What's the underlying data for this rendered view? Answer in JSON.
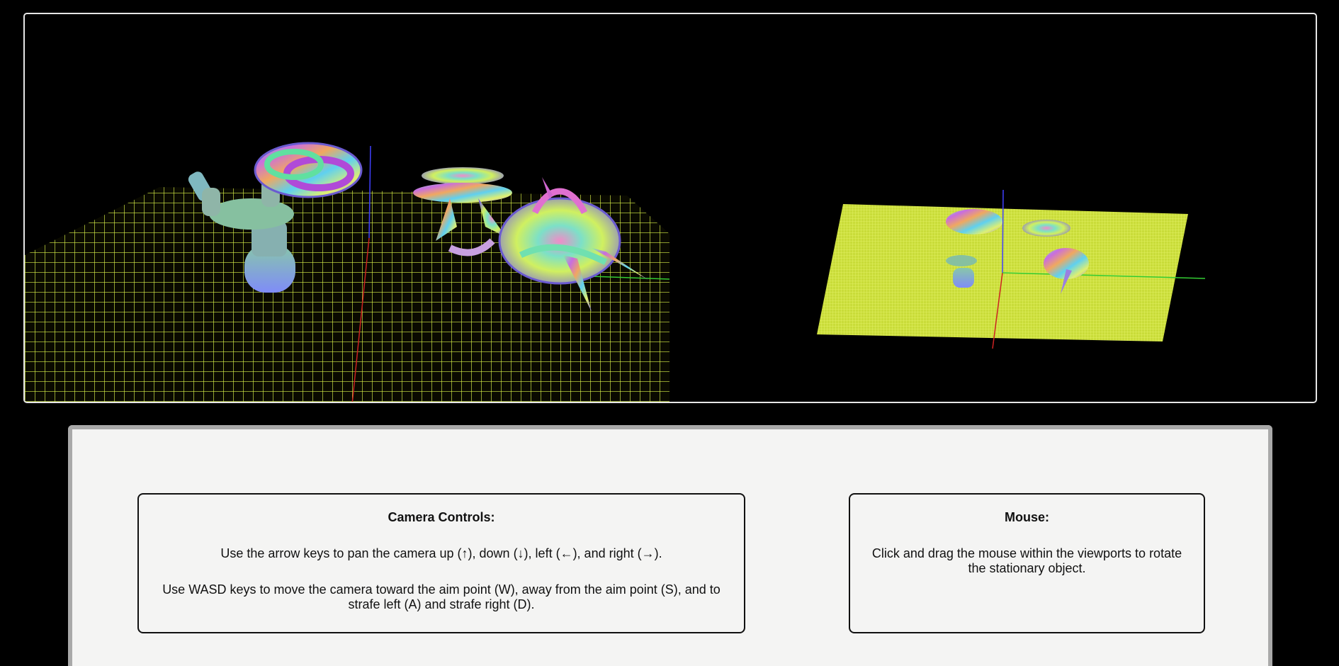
{
  "camera_controls": {
    "title": "Camera Controls:",
    "line1": "Use the arrow keys to pan the camera up (↑), down (↓), left (←), and right (→).",
    "line2": "Use WASD keys to move the camera toward the aim point (W), away from the aim point (S), and to strafe left (A) and strafe right (D)."
  },
  "mouse": {
    "title": "Mouse:",
    "line1": "Click and drag the mouse within the viewports to rotate the stationary object."
  },
  "colors": {
    "background": "#000000",
    "grid": "#d9f24a",
    "panel": "#f4f4f3",
    "axis_x": "#cc2222",
    "axis_y": "#33cc33",
    "axis_z": "#4040ff"
  }
}
